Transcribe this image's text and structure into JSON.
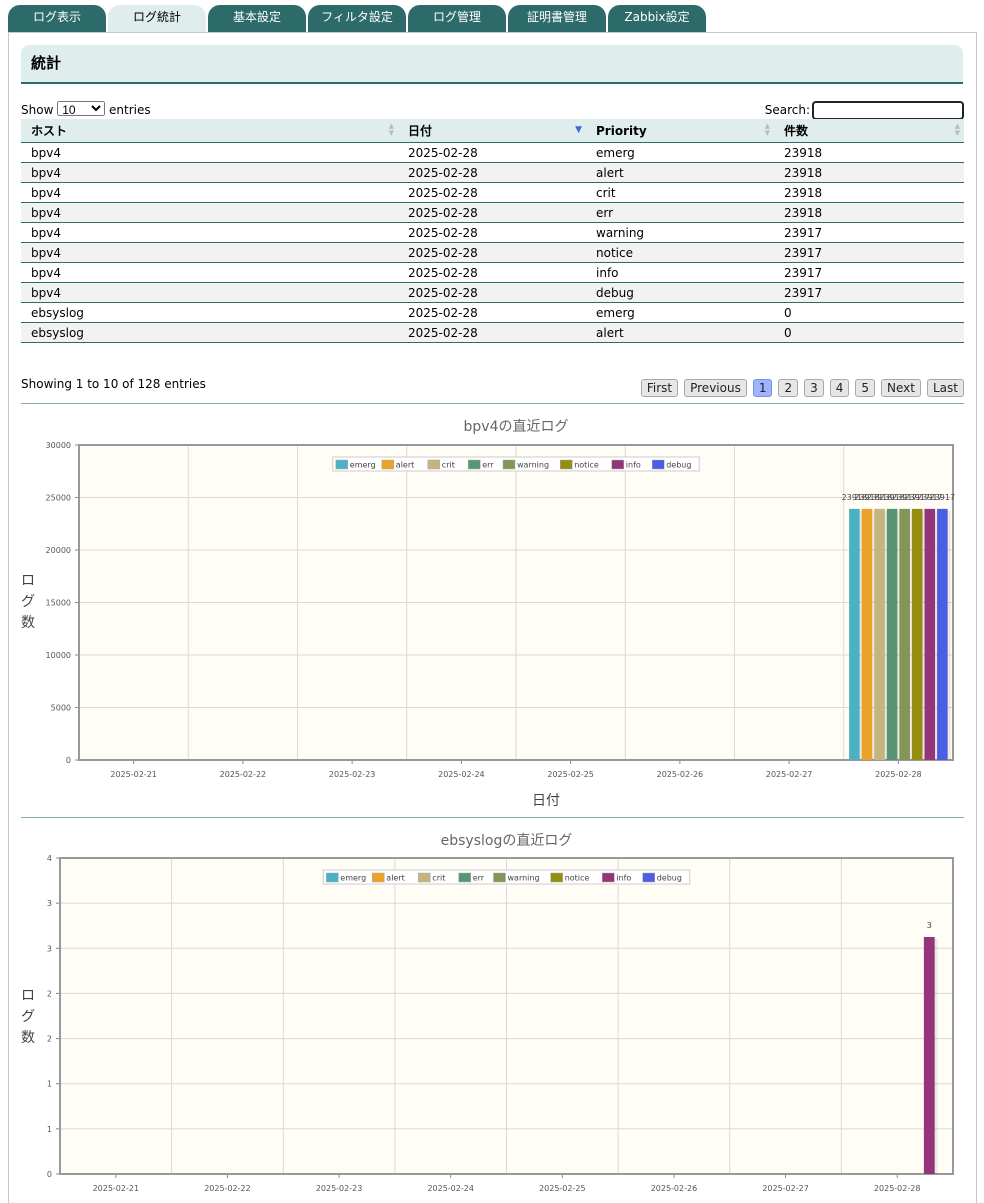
{
  "tabs": [
    "ログ表示",
    "ログ統計",
    "基本設定",
    "フィルタ設定",
    "ログ管理",
    "証明書管理",
    "Zabbix設定"
  ],
  "active_tab": 1,
  "page_title": "統計",
  "table": {
    "length_label_before": "Show",
    "length_value": "10",
    "length_label_after": "entries",
    "search_label": "Search:",
    "columns": [
      "ホスト",
      "日付",
      "Priority",
      "件数"
    ],
    "rows": [
      [
        "bpv4",
        "2025-02-28",
        "emerg",
        "23918"
      ],
      [
        "bpv4",
        "2025-02-28",
        "alert",
        "23918"
      ],
      [
        "bpv4",
        "2025-02-28",
        "crit",
        "23918"
      ],
      [
        "bpv4",
        "2025-02-28",
        "err",
        "23918"
      ],
      [
        "bpv4",
        "2025-02-28",
        "warning",
        "23917"
      ],
      [
        "bpv4",
        "2025-02-28",
        "notice",
        "23917"
      ],
      [
        "bpv4",
        "2025-02-28",
        "info",
        "23917"
      ],
      [
        "bpv4",
        "2025-02-28",
        "debug",
        "23917"
      ],
      [
        "ebsyslog",
        "2025-02-28",
        "emerg",
        "0"
      ],
      [
        "ebsyslog",
        "2025-02-28",
        "alert",
        "0"
      ]
    ],
    "info": "Showing 1 to 10 of 128 entries",
    "pager": {
      "first": "First",
      "previous": "Previous",
      "pages": [
        "1",
        "2",
        "3",
        "4",
        "5"
      ],
      "current": "1",
      "next": "Next",
      "last": "Last"
    }
  },
  "chart_data": [
    {
      "type": "bar",
      "title": "bpv4の直近ログ",
      "xlabel": "日付",
      "ylabel": "ログ数",
      "categories": [
        "2025-02-21",
        "2025-02-22",
        "2025-02-23",
        "2025-02-24",
        "2025-02-25",
        "2025-02-26",
        "2025-02-27",
        "2025-02-28"
      ],
      "ylim": [
        0,
        30000
      ],
      "yticks": [
        "0",
        "5000",
        "10000",
        "15000",
        "20000",
        "25000",
        "30000"
      ],
      "legend_position": "top-center",
      "grid": true,
      "series": [
        {
          "name": "emerg",
          "color": "#4bb2c5",
          "values": [
            0,
            0,
            0,
            0,
            0,
            0,
            0,
            23918
          ],
          "label": "23918"
        },
        {
          "name": "alert",
          "color": "#eaa228",
          "values": [
            0,
            0,
            0,
            0,
            0,
            0,
            0,
            23918
          ],
          "label": "23918"
        },
        {
          "name": "crit",
          "color": "#c5b47f",
          "values": [
            0,
            0,
            0,
            0,
            0,
            0,
            0,
            23918
          ],
          "label": "23918"
        },
        {
          "name": "err",
          "color": "#579575",
          "values": [
            0,
            0,
            0,
            0,
            0,
            0,
            0,
            23918
          ],
          "label": "23918"
        },
        {
          "name": "warning",
          "color": "#839557",
          "values": [
            0,
            0,
            0,
            0,
            0,
            0,
            0,
            23917
          ],
          "label": "23917"
        },
        {
          "name": "notice",
          "color": "#958c12",
          "values": [
            0,
            0,
            0,
            0,
            0,
            0,
            0,
            23917
          ],
          "label": "23917"
        },
        {
          "name": "info",
          "color": "#953579",
          "values": [
            0,
            0,
            0,
            0,
            0,
            0,
            0,
            23917
          ],
          "label": "23917"
        },
        {
          "name": "debug",
          "color": "#4b5de4",
          "values": [
            0,
            0,
            0,
            0,
            0,
            0,
            0,
            23917
          ],
          "label": "23917"
        }
      ]
    },
    {
      "type": "bar",
      "title": "ebsyslogの直近ログ",
      "xlabel": "",
      "ylabel": "ログ数",
      "categories": [
        "2025-02-21",
        "2025-02-22",
        "2025-02-23",
        "2025-02-24",
        "2025-02-25",
        "2025-02-26",
        "2025-02-27",
        "2025-02-28"
      ],
      "ylim": [
        0,
        4
      ],
      "yticks": [
        "0",
        "1",
        "1",
        "2",
        "2",
        "3",
        "3",
        "4"
      ],
      "legend_position": "top-center",
      "grid": true,
      "series": [
        {
          "name": "emerg",
          "color": "#4bb2c5",
          "values": [
            0,
            0,
            0,
            0,
            0,
            0,
            0,
            0
          ],
          "label": ""
        },
        {
          "name": "alert",
          "color": "#eaa228",
          "values": [
            0,
            0,
            0,
            0,
            0,
            0,
            0,
            0
          ],
          "label": ""
        },
        {
          "name": "crit",
          "color": "#c5b47f",
          "values": [
            0,
            0,
            0,
            0,
            0,
            0,
            0,
            0
          ],
          "label": ""
        },
        {
          "name": "err",
          "color": "#579575",
          "values": [
            0,
            0,
            0,
            0,
            0,
            0,
            0,
            0
          ],
          "label": ""
        },
        {
          "name": "warning",
          "color": "#839557",
          "values": [
            0,
            0,
            0,
            0,
            0,
            0,
            0,
            0
          ],
          "label": ""
        },
        {
          "name": "notice",
          "color": "#958c12",
          "values": [
            0,
            0,
            0,
            0,
            0,
            0,
            0,
            0
          ],
          "label": ""
        },
        {
          "name": "info",
          "color": "#953579",
          "values": [
            0,
            0,
            0,
            0,
            0,
            0,
            0,
            3
          ],
          "label": "3"
        },
        {
          "name": "debug",
          "color": "#4b5de4",
          "values": [
            0,
            0,
            0,
            0,
            0,
            0,
            0,
            0
          ],
          "label": ""
        }
      ]
    }
  ]
}
